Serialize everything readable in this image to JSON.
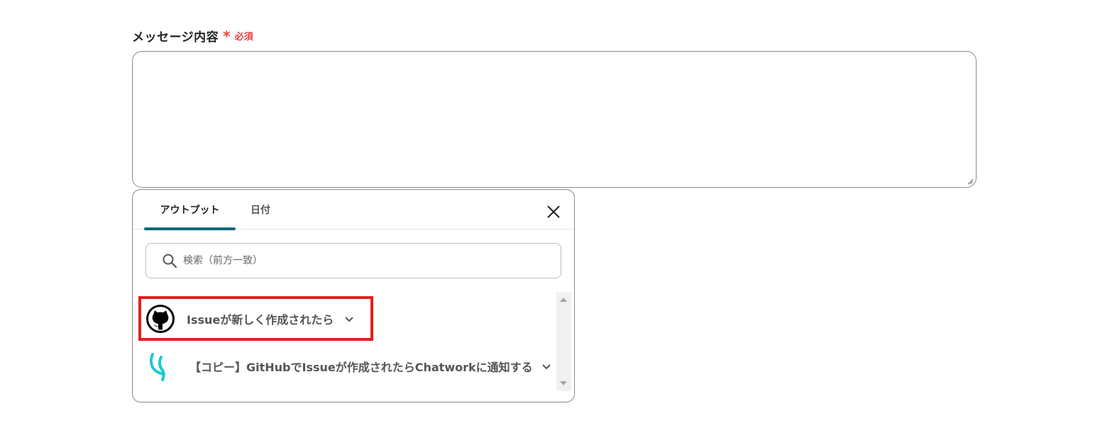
{
  "form": {
    "field_label": "メッセージ内容",
    "required_mark": "*",
    "required_text": "必須",
    "message_value": ""
  },
  "popover": {
    "tabs": [
      {
        "label": "アウトプット",
        "active": true
      },
      {
        "label": "日付",
        "active": false
      }
    ],
    "close_icon": "close-icon",
    "search": {
      "placeholder": "検索（前方一致）",
      "icon": "search-icon"
    },
    "items": [
      {
        "title": "Issueが新しく作成されたら",
        "icon": "github-icon",
        "expanded": false,
        "highlighted": true
      },
      {
        "title": "【コピー】GitHubでIssueが作成されたらChatworkに通知する",
        "icon": "yoom-icon",
        "expanded": false,
        "highlighted": false
      }
    ]
  },
  "colors": {
    "accent": "#0d6a78",
    "required": "#e8433f",
    "highlight_border": "#e3201e",
    "yoom_icon": "#1ec8d4"
  }
}
